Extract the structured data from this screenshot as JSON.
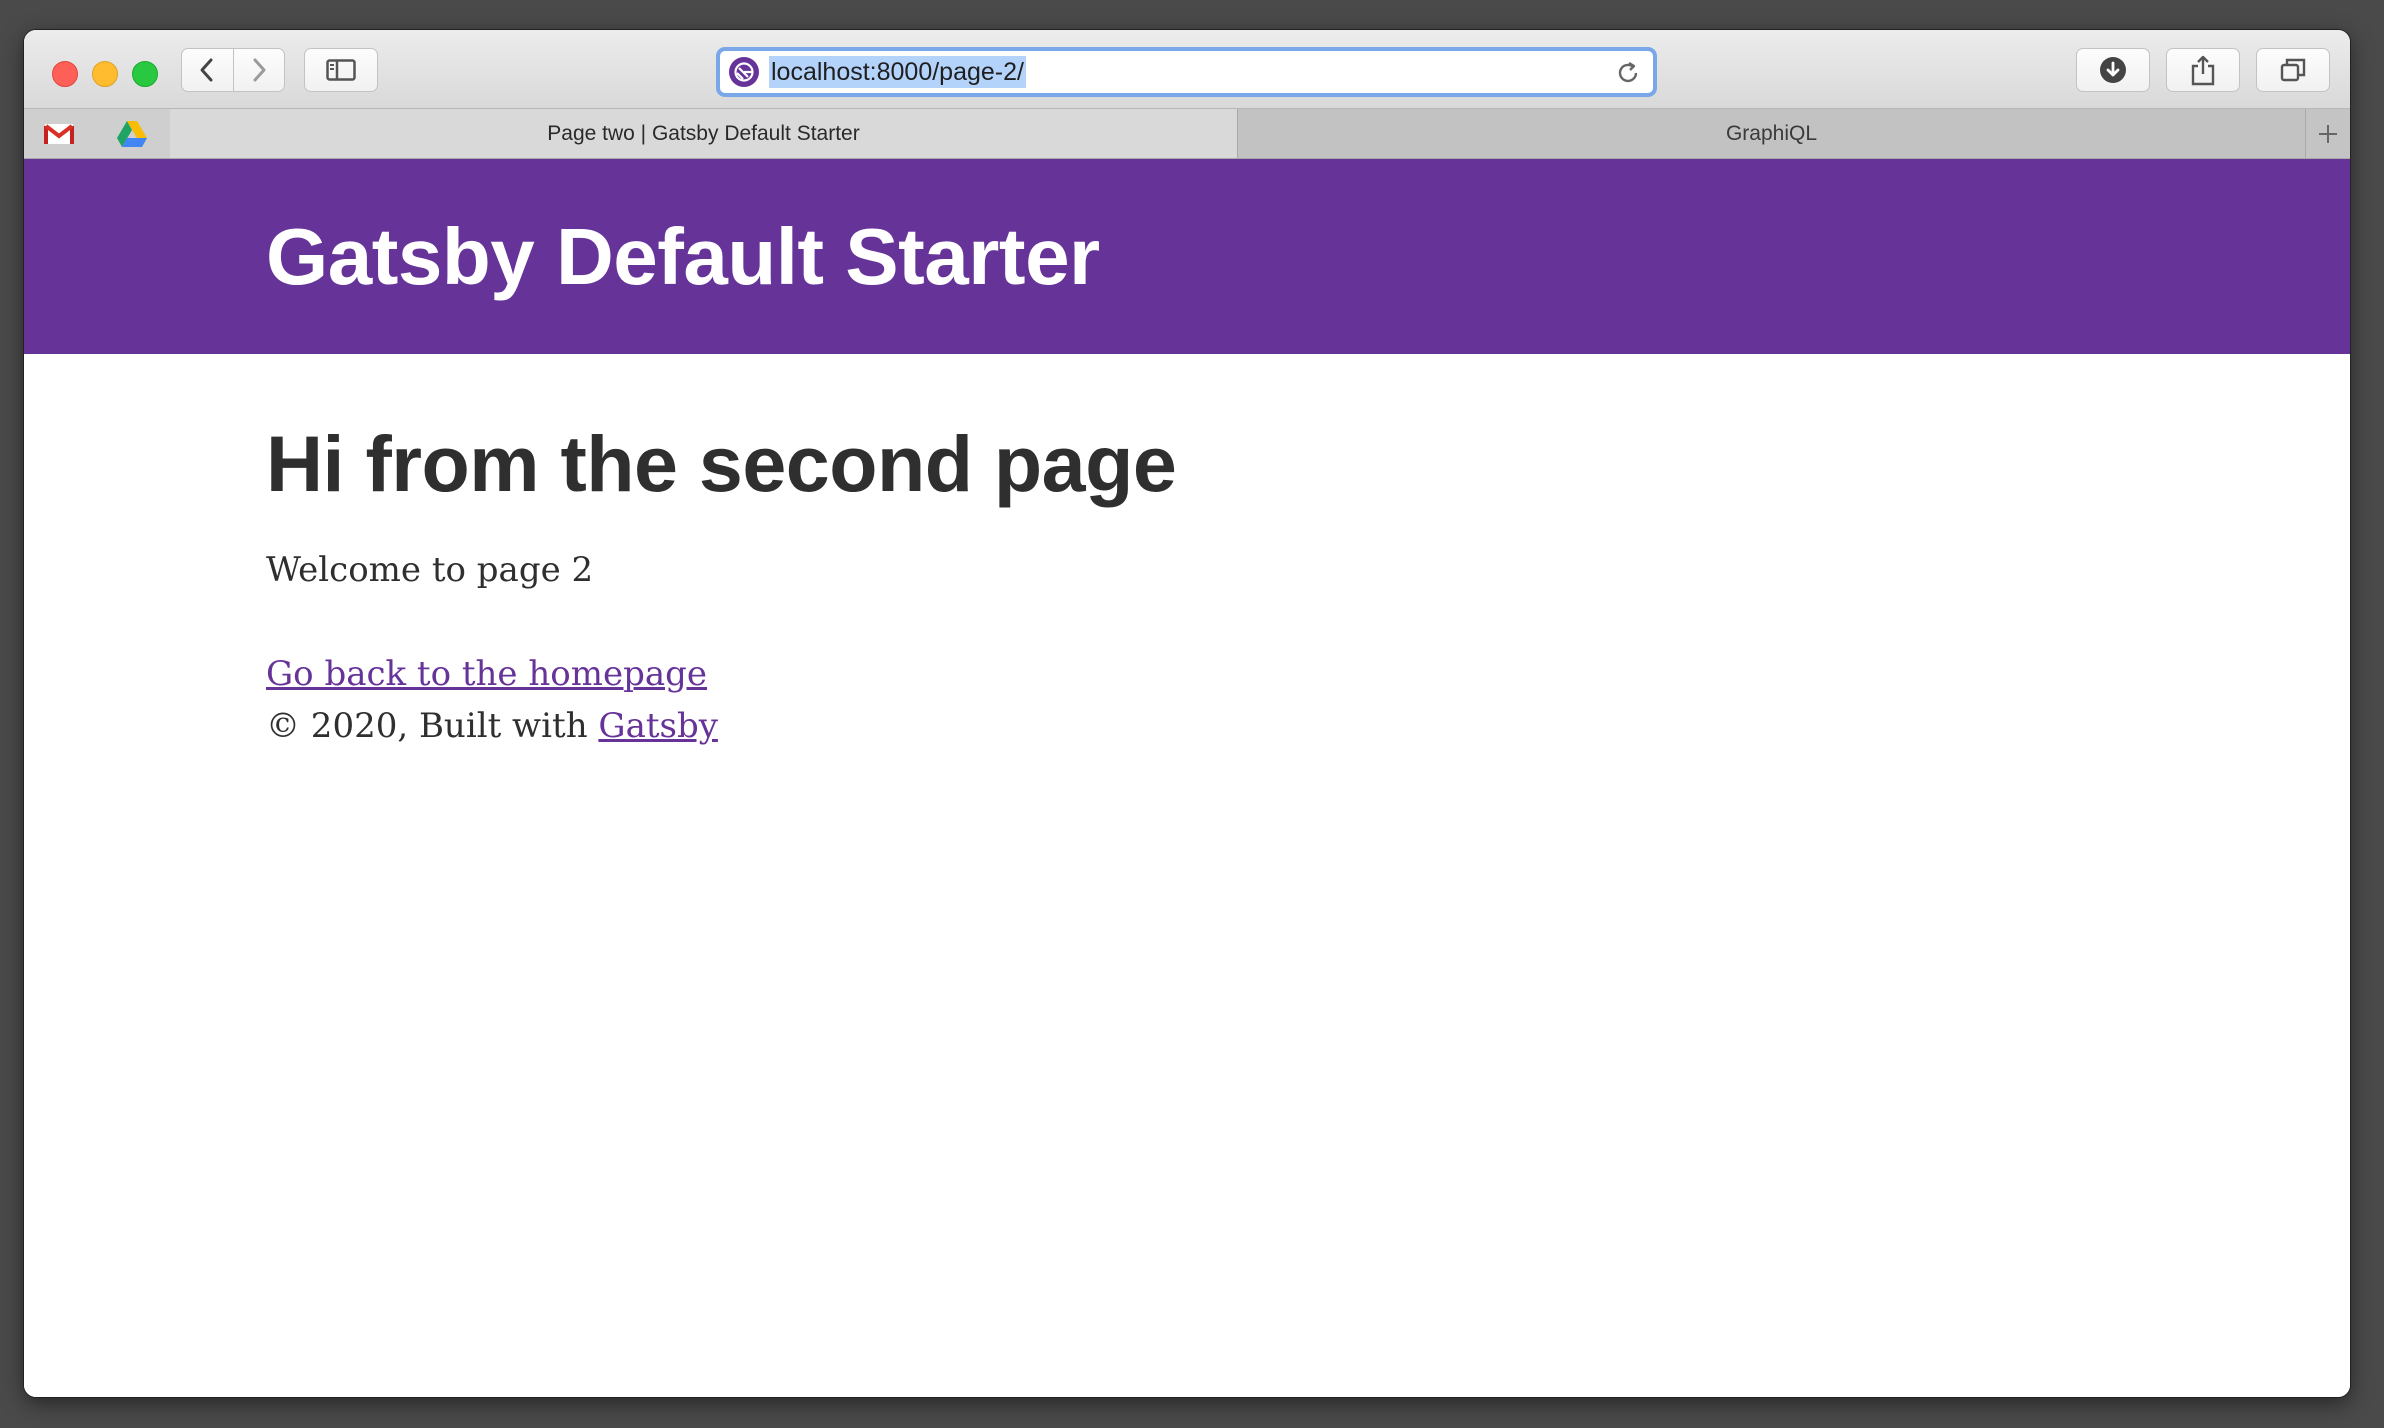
{
  "browser": {
    "url": "localhost:8000/page-2/",
    "tabs": [
      {
        "label": "Page two | Gatsby Default Starter",
        "active": true
      },
      {
        "label": "GraphiQL",
        "active": false
      }
    ],
    "pinned": [
      "gmail-icon",
      "google-drive-icon"
    ],
    "accent": "#7aa7e8"
  },
  "site": {
    "title": "Gatsby Default Starter",
    "brand_color": "#663399"
  },
  "page": {
    "heading": "Hi from the second page",
    "welcome": "Welcome to page 2",
    "back_link": "Go back to the homepage",
    "footer_prefix": "© 2020, Built with",
    "footer_link": "Gatsby"
  }
}
